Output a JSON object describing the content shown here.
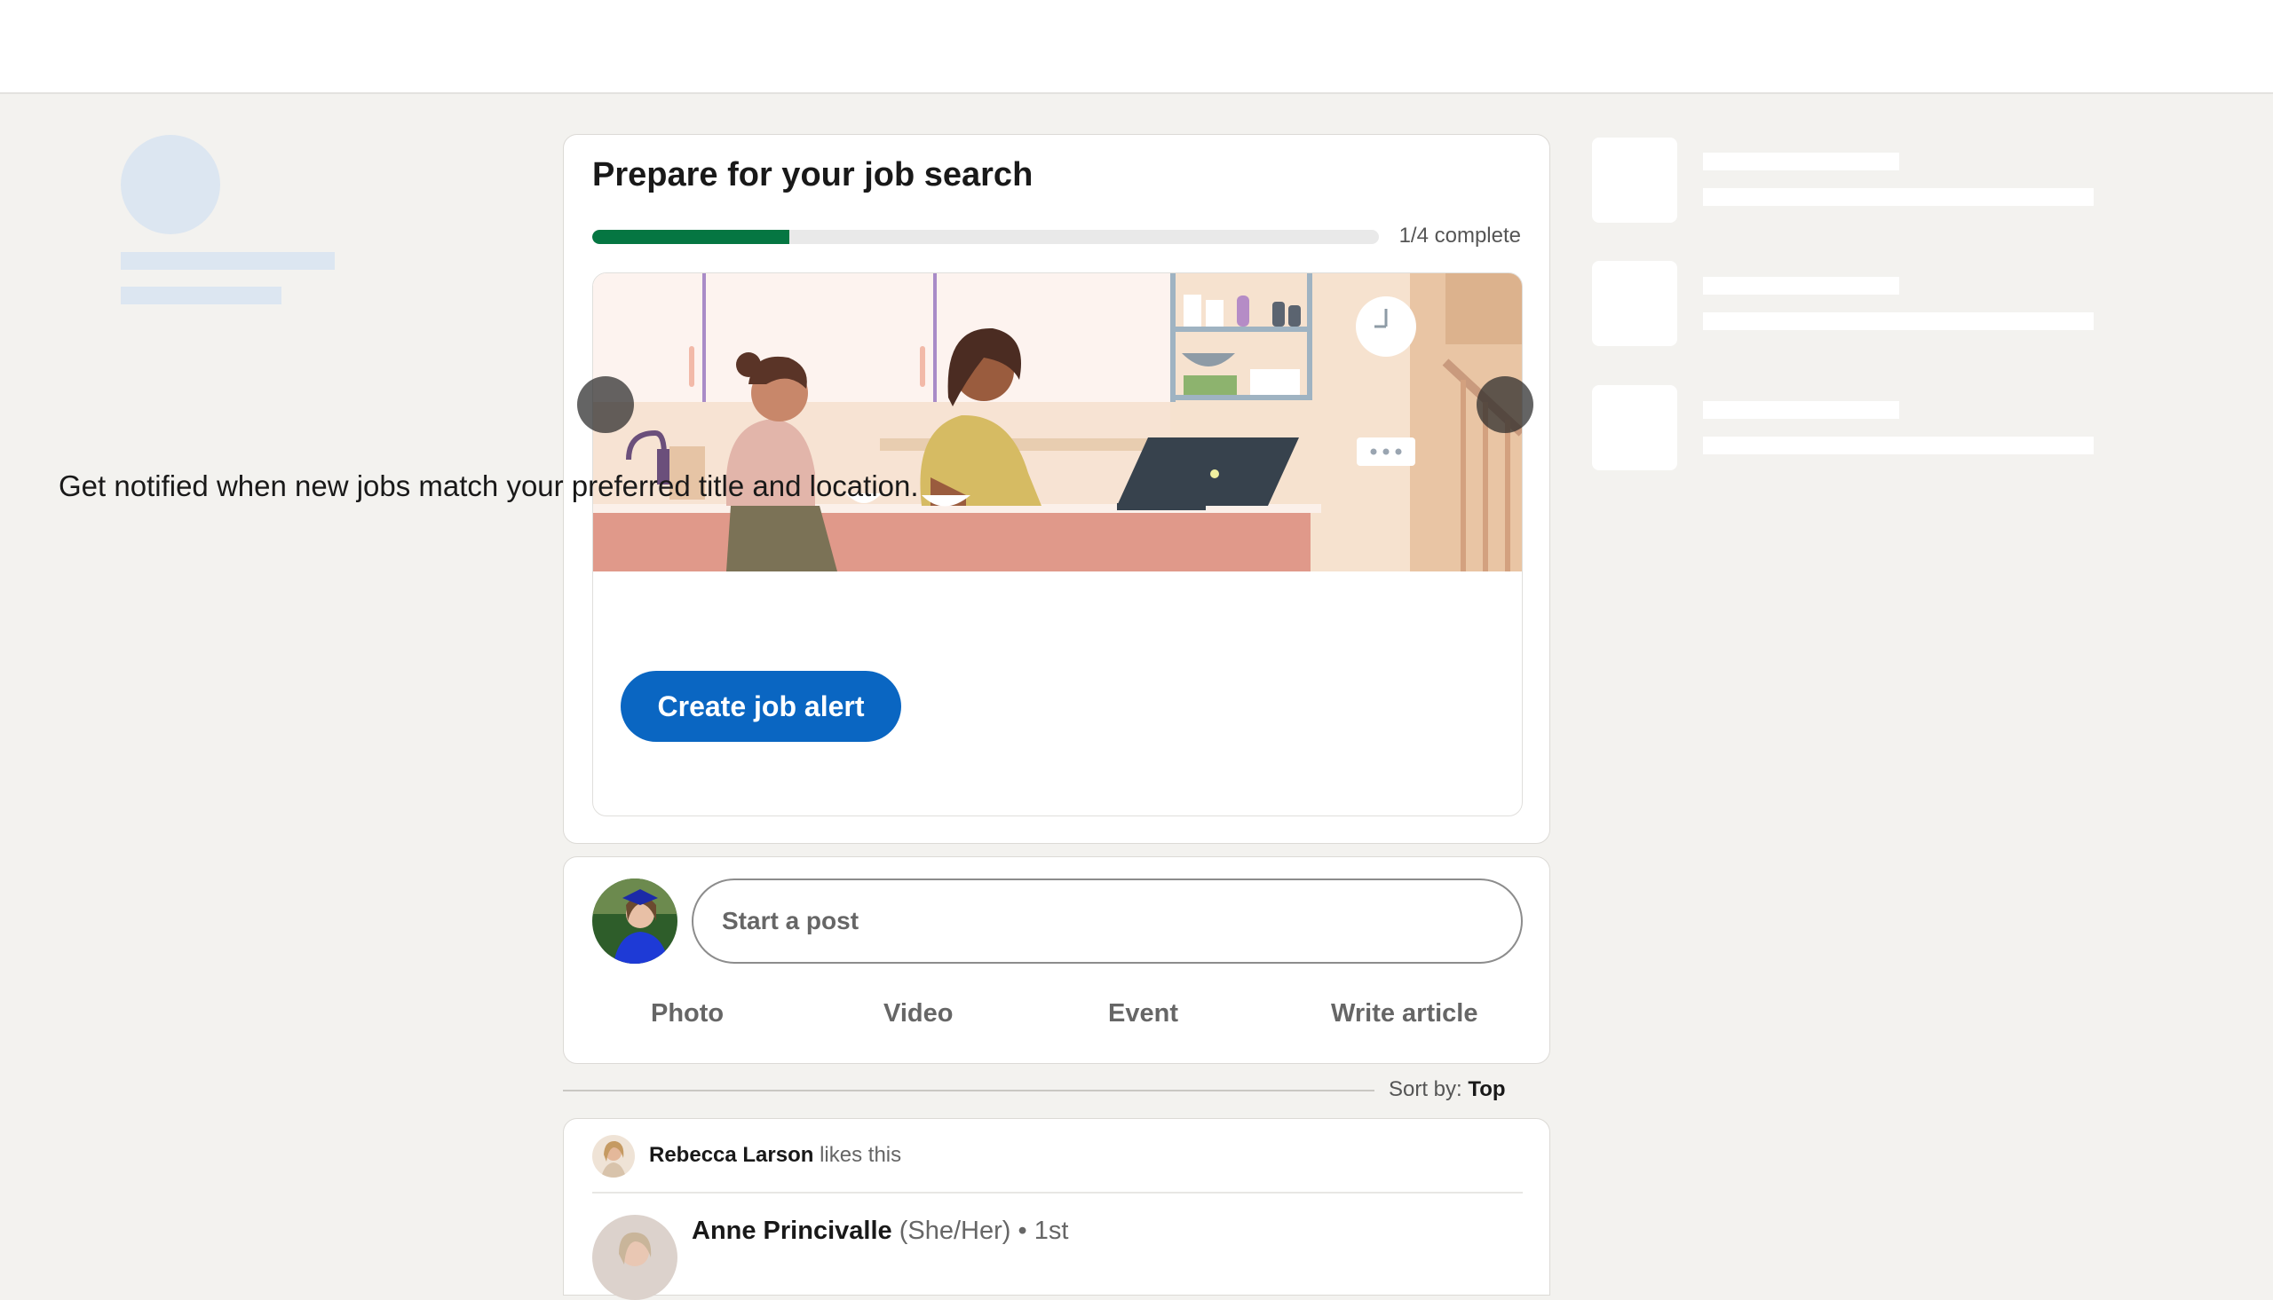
{
  "job_prep": {
    "title": "Prepare for your job search",
    "progress_text": "1/4 complete",
    "progress_fraction": 0.25,
    "description": "Get notified when new jobs match your preferred title and location.",
    "cta_label": "Create job alert",
    "progress_color": "#057642",
    "cta_color": "#0a66c2"
  },
  "composer": {
    "placeholder": "Start a post",
    "actions": [
      "Photo",
      "Video",
      "Event",
      "Write article"
    ]
  },
  "sort": {
    "label": "Sort by:",
    "value": "Top"
  },
  "feed": {
    "activity_name": "Rebecca Larson",
    "activity_text": "likes this",
    "author_name": "Anne Princivalle",
    "author_pronouns": "(She/Her)",
    "author_degree": "• 1st"
  }
}
